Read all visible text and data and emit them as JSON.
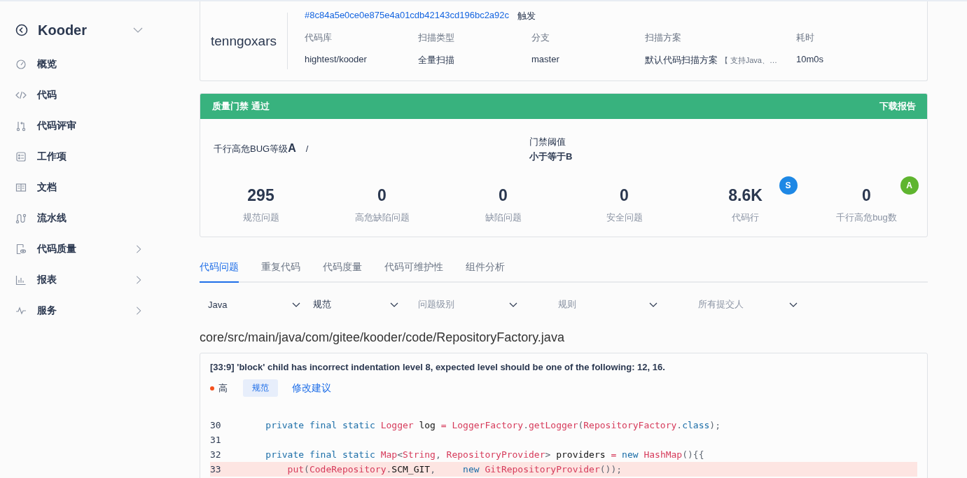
{
  "sidebar": {
    "title": "Kooder",
    "items": [
      {
        "label": "概览",
        "has_children": false
      },
      {
        "label": "代码",
        "has_children": false
      },
      {
        "label": "代码评审",
        "has_children": false
      },
      {
        "label": "工作项",
        "has_children": false
      },
      {
        "label": "文档",
        "has_children": false
      },
      {
        "label": "流水线",
        "has_children": false
      },
      {
        "label": "代码质量",
        "has_children": true
      },
      {
        "label": "报表",
        "has_children": true
      },
      {
        "label": "服务",
        "has_children": true
      }
    ]
  },
  "scan": {
    "user": "tenngoxars",
    "commit": "#8c84a5e0ce0e875e4a01cdb42143cd196bc2a92c",
    "trigger": "触发",
    "fields": [
      {
        "label": "代码库",
        "value": "hightest/kooder"
      },
      {
        "label": "扫描类型",
        "value": "全量扫描"
      },
      {
        "label": "分支",
        "value": "master"
      },
      {
        "label": "扫描方案",
        "value": "默认代码扫描方案",
        "note": "【 支持Java、…"
      },
      {
        "label": "耗时",
        "value": "10m0s"
      }
    ]
  },
  "gate": {
    "title": "质量门禁 通过",
    "passed": true,
    "download": "下载报告",
    "bug_label": "千行高危BUG等级",
    "bug_grade": "A",
    "separator": "/",
    "threshold_label": "门禁阈值",
    "threshold_value": "小于等于B",
    "stats": [
      {
        "value": "295",
        "label": "规范问题"
      },
      {
        "value": "0",
        "label": "高危缺陷问题"
      },
      {
        "value": "0",
        "label": "缺陷问题"
      },
      {
        "value": "0",
        "label": "安全问题"
      },
      {
        "value": "8.6K",
        "label": "代码行",
        "badge": "S",
        "color": "#1e88e5"
      },
      {
        "value": "0",
        "label": "千行高危bug数",
        "badge": "A",
        "color": "#5fb52f"
      }
    ]
  },
  "tabs": [
    {
      "label": "代码问题",
      "selected": true
    },
    {
      "label": "重复代码",
      "selected": false
    },
    {
      "label": "代码度量",
      "selected": false
    },
    {
      "label": "代码可维护性",
      "selected": false
    },
    {
      "label": "组件分析",
      "selected": false
    }
  ],
  "filters": [
    {
      "value": "Java"
    },
    {
      "value": "规范"
    },
    {
      "placeholder": "问题级别"
    },
    {
      "placeholder": "规则"
    },
    {
      "placeholder": "所有提交人"
    }
  ],
  "file_path": "core/src/main/java/com/gitee/kooder/code/RepositoryFactory.java",
  "issue": {
    "message": "[33:9] 'block' child has incorrect indentation level 8, expected level should be one of the following: 12, 16.",
    "severity": "高",
    "tag": "规范",
    "suggestion": "修改建议",
    "lines": [
      {
        "number": "30",
        "highlighted": false,
        "tokens": [
          {
            "text": "    private final static ",
            "kind": "kw"
          },
          {
            "text": "Logger",
            "kind": "type"
          },
          {
            "text": " log ",
            "kind": "ident"
          },
          {
            "text": "= ",
            "kind": "type"
          },
          {
            "text": "LoggerFactory",
            "kind": "type"
          },
          {
            "text": ".",
            "kind": "punct"
          },
          {
            "text": "getLogger",
            "kind": "type"
          },
          {
            "text": "(",
            "kind": "punct"
          },
          {
            "text": "RepositoryFactory",
            "kind": "type"
          },
          {
            "text": ".",
            "kind": "punct"
          },
          {
            "text": "class",
            "kind": "kw"
          },
          {
            "text": ");",
            "kind": "punct"
          }
        ]
      },
      {
        "number": "31",
        "highlighted": false
      },
      {
        "number": "32",
        "highlighted": false,
        "tokens": [
          {
            "text": "    private final static ",
            "kind": "kw"
          },
          {
            "text": "Map",
            "kind": "type"
          },
          {
            "text": "<",
            "kind": "punct"
          },
          {
            "text": "String",
            "kind": "type"
          },
          {
            "text": ", ",
            "kind": "punct"
          },
          {
            "text": "RepositoryProvider",
            "kind": "type"
          },
          {
            "text": "> ",
            "kind": "punct"
          },
          {
            "text": "providers ",
            "kind": "ident"
          },
          {
            "text": "= ",
            "kind": "type"
          },
          {
            "text": "new ",
            "kind": "kw"
          },
          {
            "text": "HashMap",
            "kind": "type"
          },
          {
            "text": "(){{",
            "kind": "punct"
          }
        ]
      },
      {
        "number": "33",
        "highlighted": true,
        "tokens": [
          {
            "text": "        put",
            "kind": "type"
          },
          {
            "text": "(",
            "kind": "punct"
          },
          {
            "text": "CodeRepository",
            "kind": "type"
          },
          {
            "text": ".",
            "kind": "punct"
          },
          {
            "text": "SCM_GIT",
            "kind": "ident"
          },
          {
            "text": ",     ",
            "kind": "punct"
          },
          {
            "text": "new ",
            "kind": "kw"
          },
          {
            "text": "GitRepositoryProvider",
            "kind": "type"
          },
          {
            "text": "());",
            "kind": "punct"
          }
        ]
      }
    ]
  }
}
